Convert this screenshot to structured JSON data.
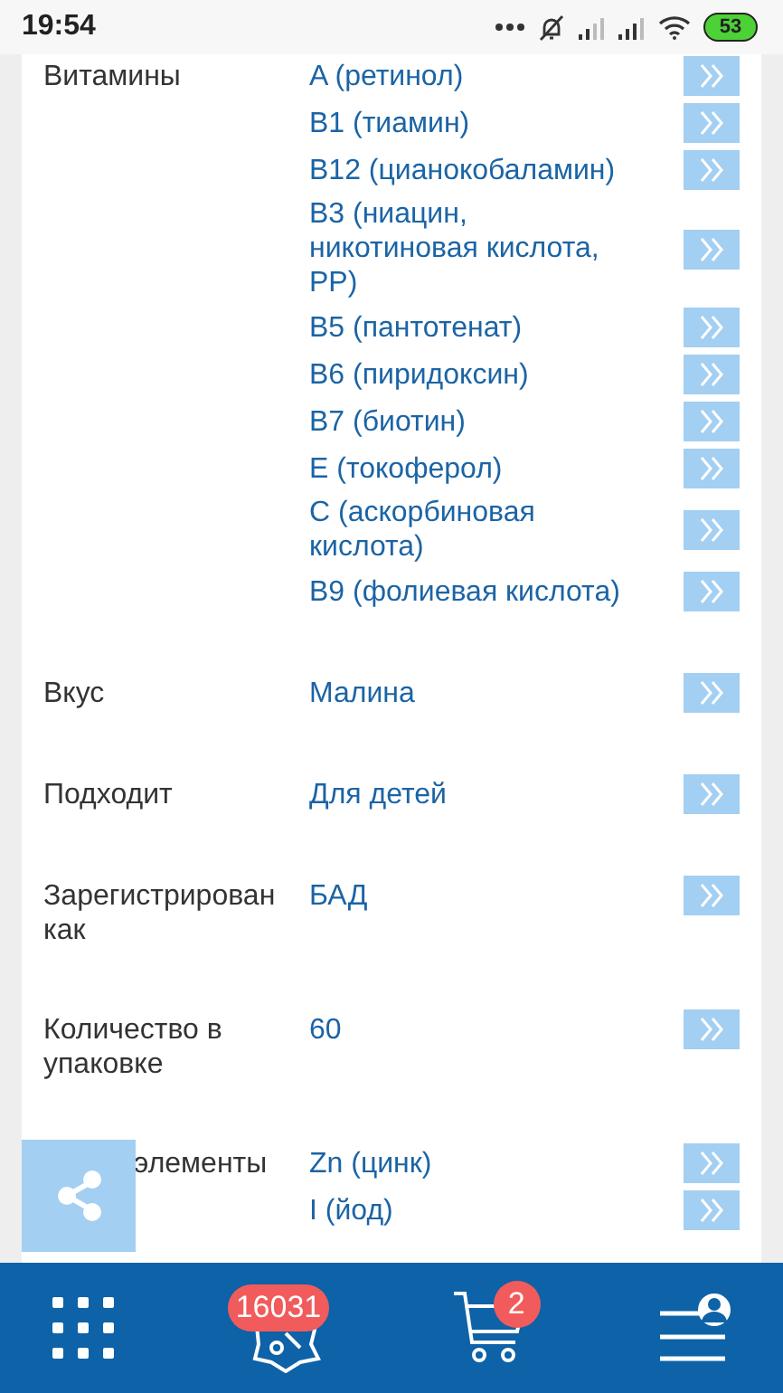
{
  "status_bar": {
    "time": "19:54",
    "battery": "53"
  },
  "specs": [
    {
      "label": "Витамины",
      "values": [
        "A (ретинол)",
        "B1 (тиамин)",
        "B12 (цианокобаламин)",
        "B3 (ниацин, никотиновая кислота, PP)",
        "B5 (пантотенат)",
        "B6 (пиридоксин)",
        "B7 (биотин)",
        "E (токоферол)",
        "C (аскорбиновая кислота)",
        "B9 (фолиевая кислота)"
      ]
    },
    {
      "label": "Вкус",
      "values": [
        "Малина"
      ]
    },
    {
      "label": "Подходит",
      "values": [
        "Для детей"
      ]
    },
    {
      "label": "Зарегистрирован как",
      "values": [
        "БАД"
      ]
    },
    {
      "label": "Количество в упаковке",
      "values": [
        "60"
      ]
    },
    {
      "label": "элементы",
      "values": [
        "Zn (цинк)",
        "I (йод)"
      ]
    }
  ],
  "bottom_nav": {
    "promo_badge": "16031",
    "cart_badge": "2"
  }
}
